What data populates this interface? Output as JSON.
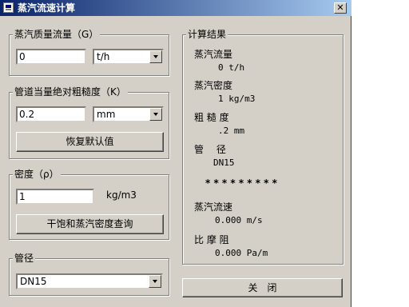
{
  "window": {
    "title": "蒸汽流速计算"
  },
  "flow_group": {
    "title": "蒸汽质量流量（G）",
    "value": "0",
    "unit": "t/h"
  },
  "roughness_group": {
    "title": "管道当量绝对粗糙度（K）",
    "value": "0.2",
    "unit": "mm",
    "reset_button": "恢复默认值"
  },
  "density_group": {
    "title": "密度（ρ）",
    "value": "1",
    "unit": "kg/m3",
    "lookup_button": "干饱和蒸汽密度查询"
  },
  "pipe_group": {
    "title": "管径",
    "value": "DN15"
  },
  "results": {
    "title": "计算结果",
    "flow_label": "蒸汽流量",
    "flow_value": "0 t/h",
    "density_label": "蒸汽密度",
    "density_value": "1 kg/m3",
    "roughness_label": "粗 糙 度",
    "roughness_value": ".2 mm",
    "pipe_label": "管　 径",
    "pipe_value": "DN15",
    "separator": "* * * * * * * * *",
    "velocity_label": "蒸汽流速",
    "velocity_value": "0.000 m/s",
    "friction_label": "比 摩 阻",
    "friction_value": "0.000 Pa/m"
  },
  "close_button": "关　闭"
}
